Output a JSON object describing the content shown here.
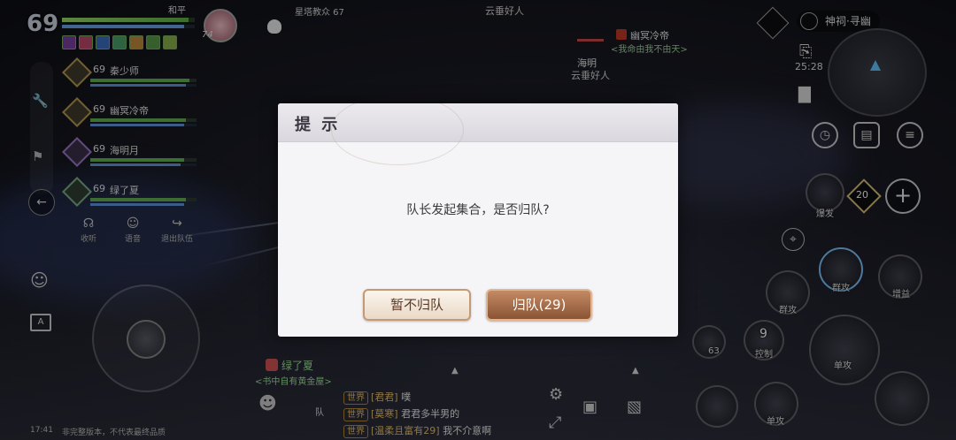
{
  "player": {
    "level": "69",
    "mode": "和平",
    "pet_level": "74",
    "onlookers": "星塔教众 67"
  },
  "team": {
    "members": [
      {
        "level": "69",
        "name": "秦少师",
        "hp": 0.93,
        "color": "gold"
      },
      {
        "level": "69",
        "name": "幽冥冷帝",
        "hp": 0.9,
        "color": "gold"
      },
      {
        "level": "69",
        "name": "海明月",
        "hp": 0.88,
        "color": "purple"
      },
      {
        "level": "69",
        "name": "绿了夏",
        "hp": 0.9,
        "color": "green"
      }
    ]
  },
  "tools": [
    {
      "icon": "headset-icon",
      "label": "收听"
    },
    {
      "icon": "voice-icon",
      "label": "语音"
    },
    {
      "icon": "leave-icon",
      "label": "退出队伍"
    }
  ],
  "world_labels": {
    "yun_top": "云垂好人",
    "enemy_name": "幽冥冷帝",
    "enemy_guild": "<我命由我不由天>",
    "ming": "海明",
    "yun_mid": "云垂好人"
  },
  "location": {
    "name": "神祠·寻幽",
    "time": "25:28"
  },
  "skills": {
    "burst": "爆发",
    "counter20": "20",
    "group_attack_hl": "群攻",
    "buff": "增益",
    "group_attack": "群攻",
    "control": "控制",
    "control_count": "9",
    "potion_count": "63",
    "single_attack": "单攻",
    "single_attack2": "单攻"
  },
  "dialog": {
    "title": "提 示",
    "message": "队长发起集合，是否归队?",
    "cancel": "暂不归队",
    "confirm": "归队(29)"
  },
  "guide": {
    "name": "绿了夏",
    "title": "<书中自有黄金屋>",
    "dui": "队"
  },
  "chat": [
    {
      "tag": "世界",
      "nick": "[君君]",
      "text": "噗"
    },
    {
      "tag": "世界",
      "nick": "[莫寒]",
      "text": "君君多半男的"
    },
    {
      "tag": "世界",
      "nick": "[温柔且富有29]",
      "text": "我不介意啊"
    }
  ],
  "status_bar": {
    "time": "17:41",
    "notice": "非完整版本，不代表最终品质"
  }
}
